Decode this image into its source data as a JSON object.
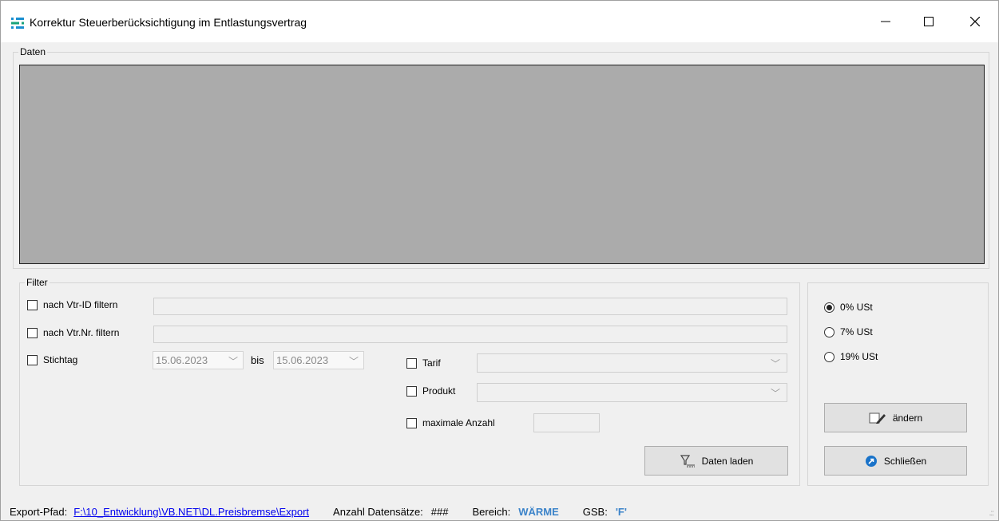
{
  "window": {
    "title": "Korrektur Steuerberücksichtigung im Entlastungsvertrag",
    "minimize": "—",
    "maximize": "☐",
    "close": "✕"
  },
  "data_group": {
    "label": "Daten"
  },
  "filter_group": {
    "label": "Filter",
    "vtr_id": {
      "label": "nach Vtr-ID filtern",
      "checked": false
    },
    "vtr_nr": {
      "label": "nach Vtr.Nr. filtern",
      "checked": false
    },
    "stichtag": {
      "label": "Stichtag",
      "checked": false,
      "from": "15.06.2023",
      "to_label": "bis",
      "to": "15.06.2023"
    },
    "tarif": {
      "label": "Tarif",
      "checked": false
    },
    "produkt": {
      "label": "Produkt",
      "checked": false
    },
    "max_anzahl": {
      "label": "maximale Anzahl",
      "checked": false
    },
    "load_button": "Daten laden"
  },
  "tax_group": {
    "options": [
      {
        "label": "0% USt",
        "selected": true
      },
      {
        "label": "7% USt",
        "selected": false
      },
      {
        "label": "19% USt",
        "selected": false
      }
    ],
    "change_button": "ändern",
    "close_button": "Schließen"
  },
  "statusbar": {
    "export_label": "Export-Pfad:",
    "export_path": "F:\\10_Entwicklung\\VB.NET\\DL.Preisbremse\\Export",
    "count_label": "Anzahl Datensätze:",
    "count_value": "###",
    "area_label": "Bereich:",
    "area_value": "WÄRME",
    "gsb_label": "GSB:",
    "gsb_value": "'F'"
  },
  "colors": {
    "accent_blue": "#3b83c9",
    "link": "#0000ee",
    "grid_bg": "#ababab"
  },
  "icons": [
    "app-icon",
    "filter-icon",
    "edit-icon",
    "close-circle-icon"
  ]
}
